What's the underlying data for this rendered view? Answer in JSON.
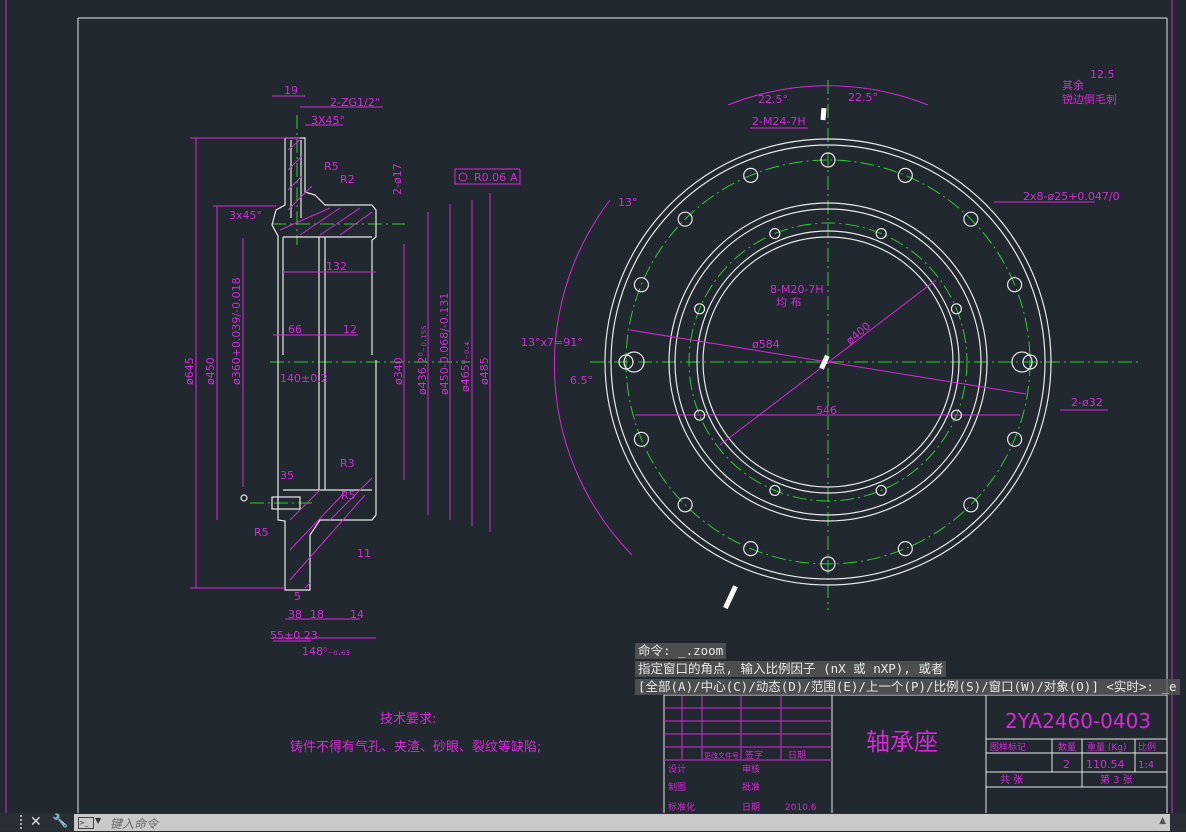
{
  "drawing": {
    "title": "轴承座",
    "drawing_number": "2YA2460-0403",
    "quantity": "2",
    "weight": "110.54",
    "scale": "1:4",
    "sheet": "第 3 张",
    "total_sheets": "共 张",
    "title_block_headers": [
      "图样标记",
      "数量",
      "重量 (Kg)",
      "比例"
    ],
    "title_block_left": [
      "标记",
      "处数",
      "更改文件号",
      "签字",
      "日期",
      "设计",
      "审核",
      "制图",
      "批准",
      "标准化",
      "日期",
      "2010.6"
    ],
    "tech_req_title": "技术要求:",
    "tech_req_text": "铸件不得有气孔、夹渣、砂眼、裂纹等缺陷;",
    "note_other": "其余",
    "note_roughness": "12.5",
    "note_deburr": "锐边倒毛刺",
    "side_labels": [
      "19",
      "2-ZG1/2\"",
      "3X45°",
      "R5",
      "R2",
      "R0.06",
      "A",
      "3x45°",
      "2-ø17",
      "132",
      "66",
      "12",
      "140±0.2",
      "35",
      "R3",
      "R5",
      "R5",
      "11",
      "5",
      "38",
      "18",
      "14",
      "55±0.23",
      "148⁰₋₀.₆₃"
    ],
    "side_vertical_labels": [
      "ø645",
      "ø450",
      "ø360+0.039/-0.018",
      "ø340",
      "ø436.2⁰₋₀.₁₅₅",
      "ø450-0.068/-0.131",
      "ø465⁰₋₀.₄",
      "ø485"
    ],
    "front_labels": [
      "22.5°",
      "22.5°",
      "2-M24-7H",
      "13°",
      "2x8-ø25+0.047/0",
      "8-M20-7H",
      "均 布",
      "13°x7=91°",
      "ø584",
      "ø400",
      "6.5°",
      "546",
      "2-ø32"
    ]
  },
  "command": {
    "line1": "命令: _.zoom",
    "line2": "指定窗口的角点, 输入比例因子 (nX 或 nXP), 或者",
    "line3": "[全部(A)/中心(C)/动态(D)/范围(E)/上一个(P)/比例(S)/窗口(W)/对象(O)] <实时>: _e",
    "placeholder": "键入命令",
    "close_icon": "close-icon",
    "wrench_icon": "customize-icon"
  },
  "colors": {
    "background": "#212830",
    "annotation": "#d62ad6",
    "geometry": "#e8e8e8",
    "centerline": "#2ecc2e"
  }
}
